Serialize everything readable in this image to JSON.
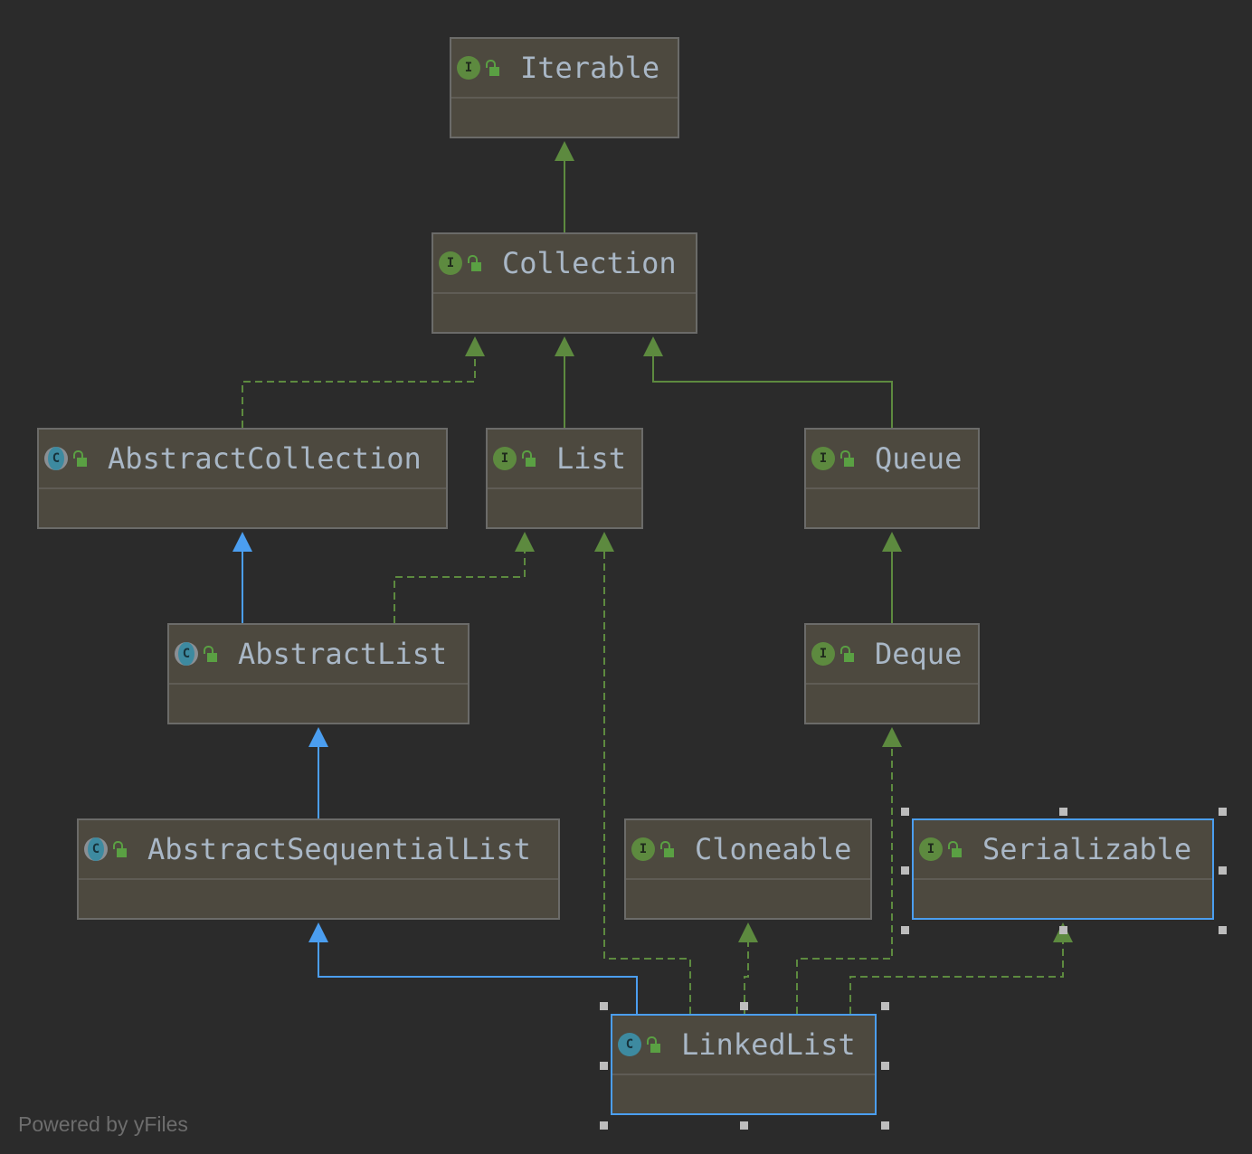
{
  "nodes": {
    "iterable": {
      "name": "Iterable",
      "kind": "interface",
      "kind_letter": "I"
    },
    "collection": {
      "name": "Collection",
      "kind": "interface",
      "kind_letter": "I"
    },
    "abstract_collection": {
      "name": "AbstractCollection",
      "kind": "abstract-class",
      "kind_letter": "C"
    },
    "list": {
      "name": "List",
      "kind": "interface",
      "kind_letter": "I"
    },
    "queue": {
      "name": "Queue",
      "kind": "interface",
      "kind_letter": "I"
    },
    "abstract_list": {
      "name": "AbstractList",
      "kind": "abstract-class",
      "kind_letter": "C"
    },
    "deque": {
      "name": "Deque",
      "kind": "interface",
      "kind_letter": "I"
    },
    "abstract_sequential_list": {
      "name": "AbstractSequentialList",
      "kind": "abstract-class",
      "kind_letter": "C"
    },
    "cloneable": {
      "name": "Cloneable",
      "kind": "interface",
      "kind_letter": "I"
    },
    "serializable": {
      "name": "Serializable",
      "kind": "interface",
      "kind_letter": "I",
      "selected": true
    },
    "linked_list": {
      "name": "LinkedList",
      "kind": "class",
      "kind_letter": "C",
      "selected": true
    }
  },
  "edges": [
    {
      "from": "Collection",
      "to": "Iterable",
      "type": "extends-interface"
    },
    {
      "from": "AbstractCollection",
      "to": "Collection",
      "type": "implements"
    },
    {
      "from": "List",
      "to": "Collection",
      "type": "extends-interface"
    },
    {
      "from": "Queue",
      "to": "Collection",
      "type": "extends-interface"
    },
    {
      "from": "AbstractList",
      "to": "AbstractCollection",
      "type": "extends-class"
    },
    {
      "from": "AbstractList",
      "to": "List",
      "type": "implements"
    },
    {
      "from": "Deque",
      "to": "Queue",
      "type": "extends-interface"
    },
    {
      "from": "AbstractSequentialList",
      "to": "AbstractList",
      "type": "extends-class"
    },
    {
      "from": "LinkedList",
      "to": "AbstractSequentialList",
      "type": "extends-class"
    },
    {
      "from": "LinkedList",
      "to": "List",
      "type": "implements"
    },
    {
      "from": "LinkedList",
      "to": "Cloneable",
      "type": "implements"
    },
    {
      "from": "LinkedList",
      "to": "Deque",
      "type": "implements"
    },
    {
      "from": "LinkedList",
      "to": "Serializable",
      "type": "implements"
    }
  ],
  "colors": {
    "background": "#2b2b2b",
    "interface_edge": "#5d8a3f",
    "class_edge": "#4b9ef0",
    "selection": "#4b9ef0"
  },
  "footer": "Powered by yFiles"
}
